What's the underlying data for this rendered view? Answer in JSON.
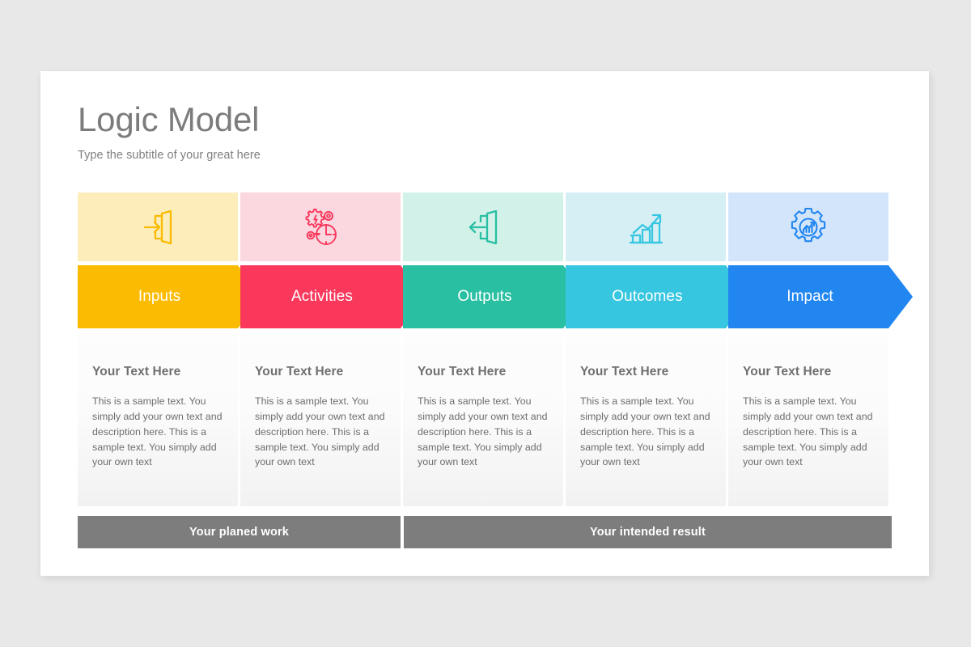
{
  "slide": {
    "title": "Logic Model",
    "subtitle": "Type the subtitle of your great here"
  },
  "colors": {
    "canvas_background": "#e8e8e9",
    "slide_background": "#ffffff",
    "title_text": "#7c7c7c",
    "subtitle_text": "#808080",
    "card_heading_text": "#6f6f6f",
    "card_body_text": "#6d6d6d",
    "footer_bar": "#7d7d7d"
  },
  "columns": [
    {
      "id": "inputs",
      "label": "Inputs",
      "icon": "login-door-arrow-in-icon",
      "accent": "#FABB00",
      "icon_tint": "#FCEDBB",
      "heading": "Your Text Here",
      "body": "This is a sample text. You simply add your own text and description here. This is a sample text. You simply add your own text"
    },
    {
      "id": "activities",
      "label": "Activities",
      "icon": "gears-lightning-clock-icon",
      "accent": "#F9385C",
      "icon_tint": "#FBD7DF",
      "heading": "Your Text Here",
      "body": "This is a sample text. You simply add your own text and description here. This is a sample text. You simply add your own text"
    },
    {
      "id": "outputs",
      "label": "Outputs",
      "icon": "logout-door-arrow-out-icon",
      "accent": "#29BFA2",
      "icon_tint": "#D2F1E9",
      "heading": "Your Text Here",
      "body": "This is a sample text. You simply add your own text and description here. This is a sample text. You simply add your own text"
    },
    {
      "id": "outcomes",
      "label": "Outcomes",
      "icon": "growth-bar-chart-arrow-icon",
      "accent": "#36C6E0",
      "icon_tint": "#D5EFF5",
      "heading": "Your Text Here",
      "body": "This is a sample text. You simply add your own text and description here. This is a sample text. You simply add your own text"
    },
    {
      "id": "impact",
      "label": "Impact",
      "icon": "gear-analytics-chart-icon",
      "accent": "#2186F0",
      "icon_tint": "#D3E5FB",
      "heading": "Your Text Here",
      "body": "This is a sample text. You simply add your own text and description here. This is a sample text. You simply add your own text"
    }
  ],
  "footer": {
    "left_label": "Your planed work",
    "right_label": "Your intended result"
  }
}
